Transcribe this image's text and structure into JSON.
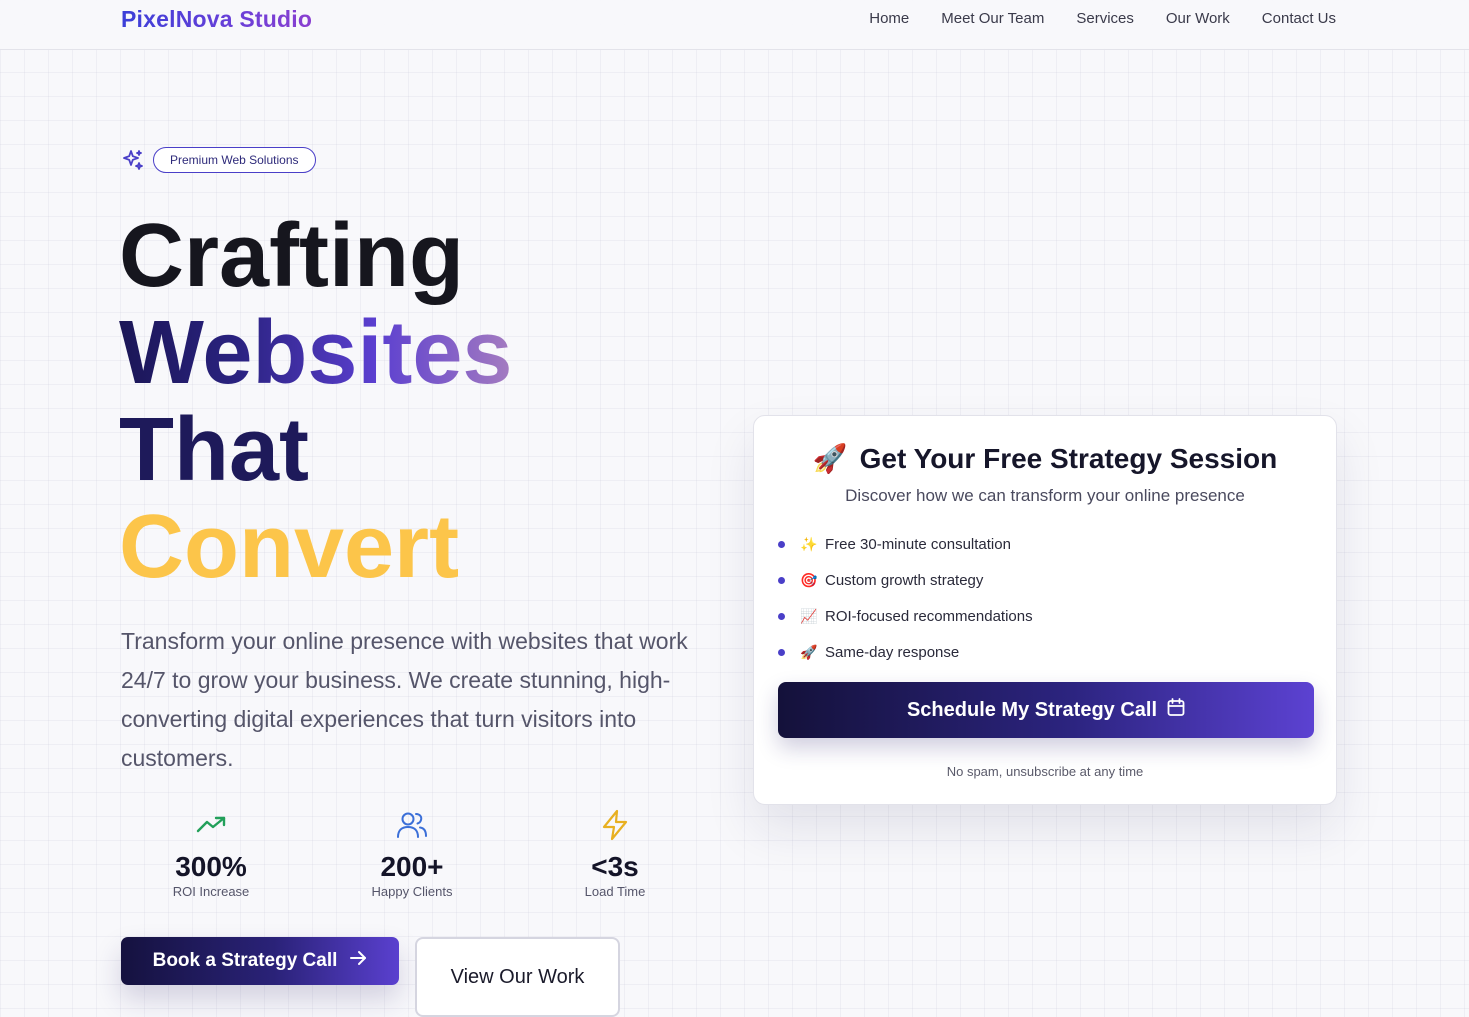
{
  "header": {
    "brand": "PixelNova Studio",
    "nav": [
      "Home",
      "Meet Our Team",
      "Services",
      "Our Work",
      "Contact Us"
    ]
  },
  "hero": {
    "badge": "Premium Web Solutions",
    "headline": [
      "Crafting",
      "Websites",
      "That",
      "Convert"
    ],
    "subcopy": "Transform your online presence with websites that work 24/7 to grow your business. We create stunning, high-converting digital experiences that turn visitors into customers.",
    "stats": [
      {
        "icon": "trending-up-icon",
        "value": "300%",
        "label": "ROI Increase",
        "color": "#22a05a"
      },
      {
        "icon": "users-icon",
        "value": "200+",
        "label": "Happy Clients",
        "color": "#3b6fd8"
      },
      {
        "icon": "lightning-icon",
        "value": "<3s",
        "label": "Load Time",
        "color": "#e8b020"
      }
    ],
    "primary_cta": "Book a Strategy Call",
    "secondary_cta": "View Our Work"
  },
  "card": {
    "title": "Get Your Free Strategy Session",
    "subtitle": "Discover how we can transform your online presence",
    "features": [
      {
        "emoji": "✨",
        "text": "Free 30-minute consultation"
      },
      {
        "emoji": "🎯",
        "text": "Custom growth strategy"
      },
      {
        "emoji": "📈",
        "text": "ROI-focused recommendations"
      },
      {
        "emoji": "🚀",
        "text": "Same-day response"
      }
    ],
    "cta": "Schedule My Strategy Call",
    "note": "No spam, unsubscribe at any time"
  },
  "colors": {
    "accent": "#4a3fc8",
    "headline_yellow": "#fcc54a",
    "dark_navy": "#15123f"
  }
}
